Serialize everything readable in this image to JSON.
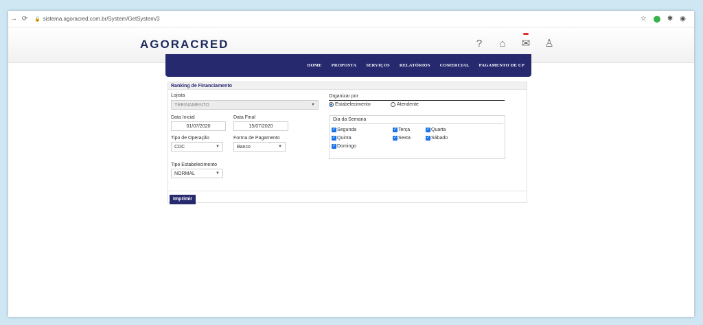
{
  "browser": {
    "url": "sistema.agoracred.com.br/System/GetSystem/3",
    "back_icon": "arrow-right",
    "reload_icon": "reload"
  },
  "header": {
    "logo": "AGORACRED"
  },
  "menu": {
    "items": [
      "HOME",
      "PROPOSTA",
      "SERVIÇOS",
      "RELATÓRIOS",
      "COMERCIAL",
      "PAGAMENTO DE CP"
    ]
  },
  "form": {
    "title": "Ranking de Financiamento",
    "lojista_label": "Lojista",
    "lojista_value": "TREINAMENTO",
    "data_inicial_label": "Data Inicial",
    "data_inicial_value": "01/07/2020",
    "data_final_label": "Data Final",
    "data_final_value": "15/07/2020",
    "tipo_operacao_label": "Tipo de Operação",
    "tipo_operacao_value": "CDC",
    "forma_pagamento_label": "Forma de Pagamento",
    "forma_pagamento_value": "Banco",
    "tipo_estabelecimento_label": "Tipo Estabelecimento",
    "tipo_estabelecimento_value": "NORMAL",
    "organizar_label": "Organizar por",
    "radio_estabelecimento": "Estabelecimento",
    "radio_atendente": "Atendente",
    "dia_semana_label": "Dia da Semana",
    "days": [
      "Segunda",
      "Terça",
      "Quarta",
      "Quinta",
      "Sexta",
      "Sábado",
      "Domingo"
    ],
    "print_label": "Imprimir"
  }
}
